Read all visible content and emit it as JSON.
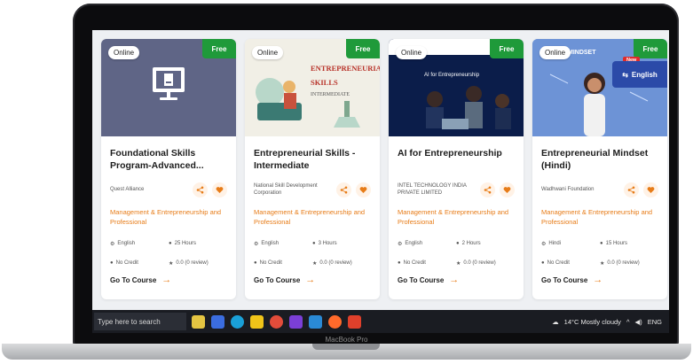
{
  "device": {
    "brand_label": "MacBook Pro"
  },
  "cards": [
    {
      "online": "Online",
      "free": "Free",
      "title": "Foundational Skills Program-Advanced...",
      "provider": "Quest Alliance",
      "category": "Management & Entrepreneurship and Professional",
      "language": "English",
      "duration": "25 Hours",
      "credit": "No Credit",
      "rating": "0.0 (0 review)",
      "cta": "Go To Course"
    },
    {
      "online": "Online",
      "free": "Free",
      "title": "Entrepreneurial Skills - Intermediate",
      "provider": "National Skill Development Corporation",
      "category": "Management & Entrepreneurship and Professional",
      "language": "English",
      "duration": "3 Hours",
      "credit": "No Credit",
      "rating": "0.0 (0 review)",
      "cta": "Go To Course",
      "thumb_text": [
        "ENTREPRENEURIAL",
        "SKILLS",
        "INTERMEDIATE"
      ]
    },
    {
      "online": "Online",
      "free": "Free",
      "title": "AI for Entrepreneurship",
      "provider": "INTEL TECHNOLOGY INDIA PRIVATE LIMITED",
      "category": "Management & Entrepreneurship and Professional",
      "language": "English",
      "duration": "2 Hours",
      "credit": "No Credit",
      "rating": "0.0 (0 review)",
      "cta": "Go To Course",
      "thumb_text": "AI for Entrepreneurship"
    },
    {
      "online": "Online",
      "free": "Free",
      "title": "Entrepreneurial Mindset (Hindi)",
      "provider": "Wadhwani Foundation",
      "category": "Management & Entrepreneurship and Professional",
      "language": "Hindi",
      "duration": "15 Hours",
      "credit": "No Credit",
      "rating": "0.0 (0 review)",
      "cta": "Go To Course",
      "thumb_text": "MINDSET"
    }
  ],
  "language_widget": {
    "new": "New",
    "label": "English"
  },
  "taskbar": {
    "search_placeholder": "Type here to search",
    "weather": "14°C  Mostly cloudy",
    "lang": "ENG"
  },
  "colors": {
    "accent": "#e77c18",
    "free": "#1f9a3a",
    "taskbar": "#1a1c22"
  }
}
